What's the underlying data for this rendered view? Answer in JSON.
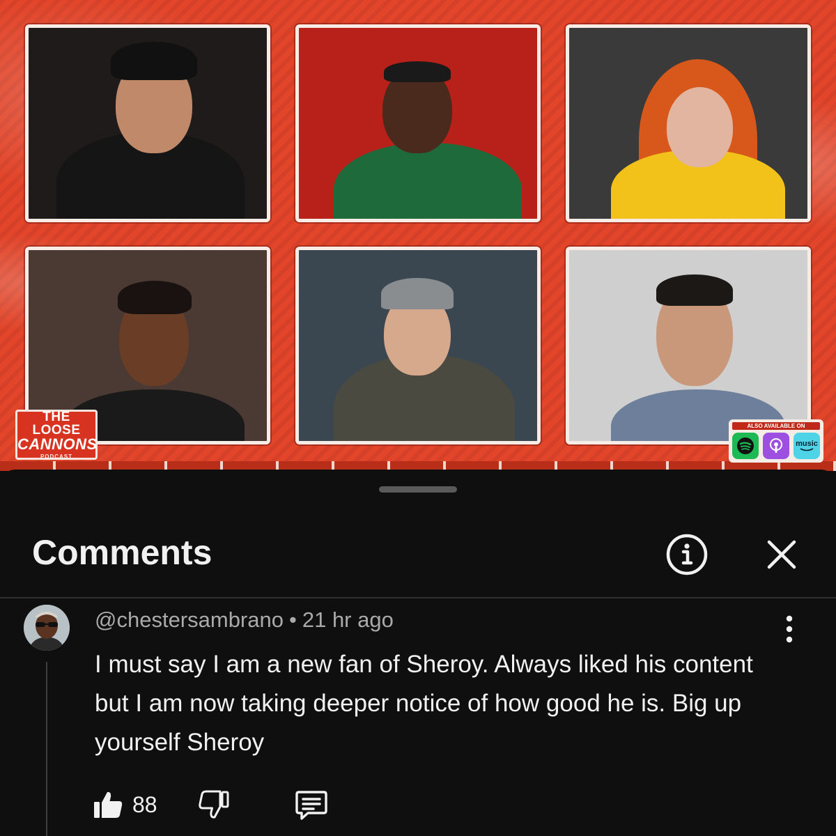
{
  "video": {
    "logo": {
      "line1": "THE LOOSE",
      "line2": "CANNONS",
      "line3": "PODCAST"
    },
    "also_available": {
      "caption": "ALSO AVAILABLE ON",
      "music_label": "music"
    },
    "tiles": [
      {
        "name": "participant-1",
        "bg": "#1e1b1a",
        "skin": "#c08a6a",
        "shirt": "#151515",
        "hair": "#111111"
      },
      {
        "name": "participant-2",
        "bg": "#b8201a",
        "skin": "#4a2a1c",
        "shirt": "#1f6a3a",
        "hair": "#1a1a1a"
      },
      {
        "name": "participant-3",
        "bg": "#3a3a3a",
        "skin": "#e2b5a0",
        "shirt": "#f2c21a",
        "hair": "#d8581c"
      },
      {
        "name": "participant-4",
        "bg": "#4a3a33",
        "skin": "#6a3d26",
        "shirt": "#1a1a1a",
        "hair": "#1a1210"
      },
      {
        "name": "participant-5",
        "bg": "#3a4650",
        "skin": "#d6a88c",
        "shirt": "#4a4a40",
        "hair": "#8a8d90"
      },
      {
        "name": "participant-6",
        "bg": "#cfcfcf",
        "skin": "#c9987a",
        "shirt": "#6d7f9a",
        "hair": "#1c1816"
      }
    ]
  },
  "panel": {
    "title": "Comments",
    "comment": {
      "author": "@chestersambrano",
      "separator": "•",
      "time": "21 hr ago",
      "text": "I must say I am a new fan of Sheroy. Always liked his content but I am now taking deeper notice of how good he is. Big up yourself Sheroy",
      "likes": "88"
    }
  },
  "colors": {
    "panel_bg": "#0f0f0f",
    "text_primary": "#f1f1f1",
    "text_secondary": "#aaaaaa",
    "brand_red": "#e2452a"
  },
  "icons": {
    "info": "info-circle-icon",
    "close": "close-icon",
    "more": "more-vertical-icon",
    "like": "thumbs-up-icon",
    "dislike": "thumbs-down-icon",
    "reply": "comment-reply-icon"
  }
}
